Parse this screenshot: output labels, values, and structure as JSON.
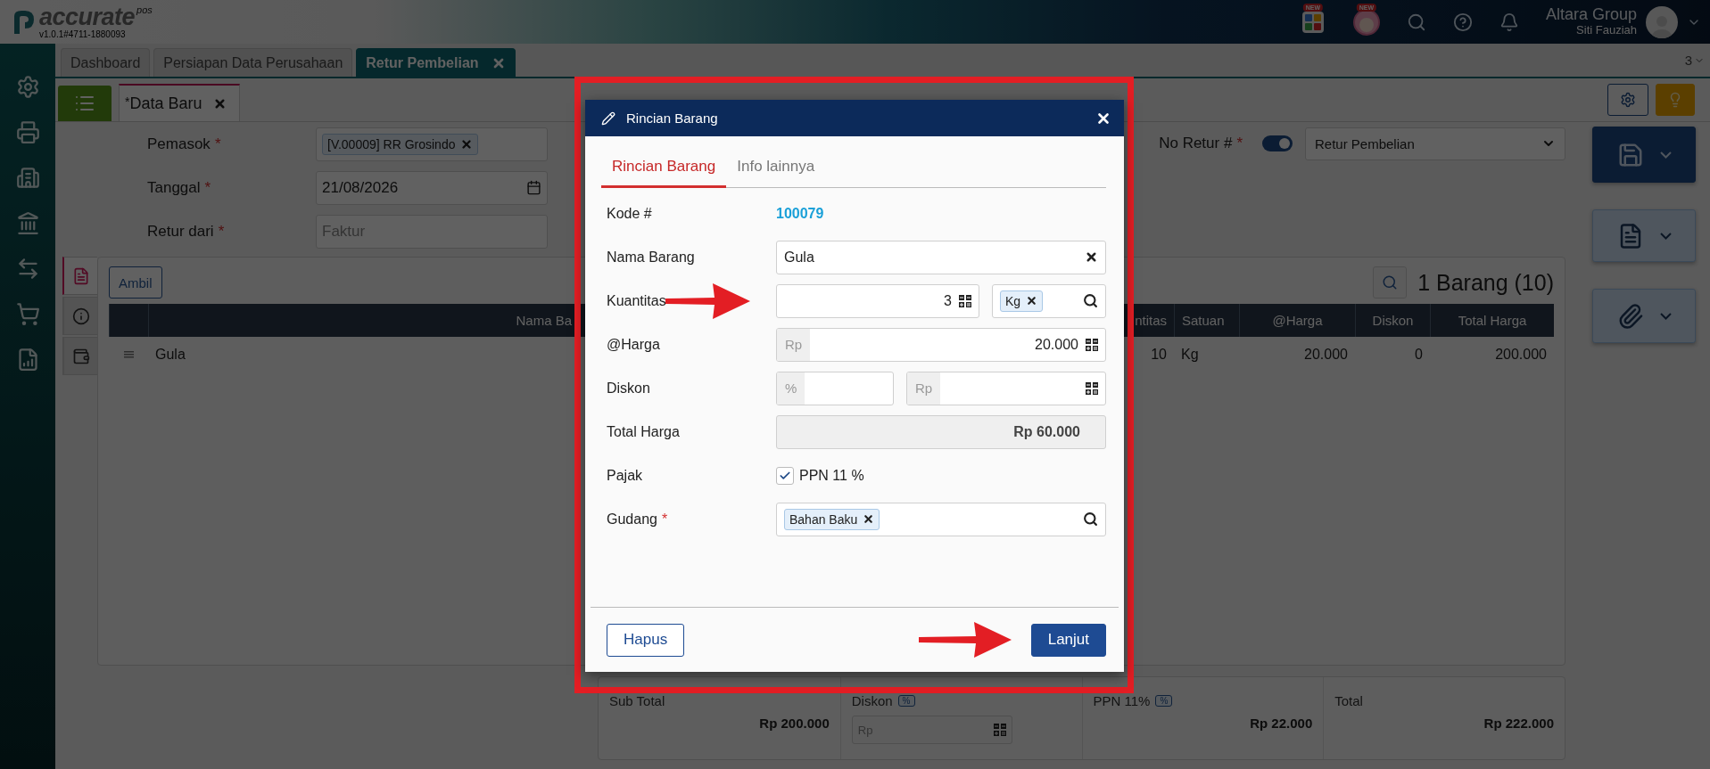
{
  "header": {
    "logo": "accurate",
    "logo_tag": "pos",
    "version": "v1.0.1#4711-1880093",
    "apps_badge": "NEW",
    "mascot_badge": "NEW",
    "company": "Altara Group",
    "user": "Siti Fauziah"
  },
  "tabs": [
    {
      "label": "Dashboard",
      "selected": false,
      "closable": false
    },
    {
      "label": "Persiapan Data Perusahaan",
      "selected": false,
      "closable": false
    },
    {
      "label": "Retur Pembelian",
      "selected": true,
      "closable": true
    }
  ],
  "tab_count": "3",
  "subtab": {
    "mark": "*",
    "label": "Data Baru"
  },
  "form": {
    "fields": [
      {
        "kind": "tag",
        "label": "Pemasok",
        "mark": "*",
        "value": "[V.00009] RR Grosindo"
      },
      {
        "kind": "date",
        "label": "Tanggal",
        "mark": "*",
        "value": "21/08/2026"
      },
      {
        "kind": "text",
        "label": "Retur dari",
        "mark": "*",
        "placeholder": "Faktur"
      }
    ],
    "number_label": "No Retur #",
    "number_mark": "*",
    "auto_number": true,
    "number_type": "Retur Pembelian"
  },
  "detail": {
    "side_tabs": [
      {
        "kind": "document",
        "selected": true
      },
      {
        "kind": "info",
        "selected": false
      },
      {
        "kind": "money",
        "selected": false
      }
    ],
    "fetch_button": "Ambil",
    "count": "1 Barang (10)",
    "columns": [
      "Nama Ba",
      "ntitas",
      "Satuan",
      "@Harga",
      "Diskon",
      "Total Harga"
    ],
    "rows": [
      {
        "name": "Gula",
        "quantity": "10",
        "unit": "Kg",
        "price": "20.000",
        "discount": "0",
        "total": "200.000"
      }
    ]
  },
  "summary": {
    "subtotal_label": "Sub Total",
    "subtotal": "Rp 200.000",
    "discount_label": "Diskon",
    "discount_badge": "%",
    "discount_placeholder": "Rp",
    "tax_label": "PPN 11%",
    "tax_badge": "%",
    "tax": "Rp 22.000",
    "total_label": "Total",
    "total": "Rp 222.000"
  },
  "dialog": {
    "title": "Rincian Barang",
    "tabs": [
      {
        "label": "Rincian Barang",
        "selected": true
      },
      {
        "label": "Info lainnya",
        "selected": false
      }
    ],
    "rows": [
      {
        "kind": "link",
        "label": "Kode #",
        "value": "100079"
      },
      {
        "kind": "text",
        "label": "Nama Barang",
        "value": "Gula"
      },
      {
        "kind": "quantity",
        "label": "Kuantitas",
        "value": "3",
        "unit": "Kg",
        "pointed": true
      },
      {
        "kind": "price",
        "label": "@Harga",
        "prefix": "Rp",
        "value": "20.000"
      },
      {
        "kind": "discount",
        "label": "Diskon",
        "percent_prefix": "%",
        "amount_prefix": "Rp"
      },
      {
        "kind": "readonly",
        "label": "Total Harga",
        "value": "Rp 60.000"
      },
      {
        "kind": "checkbox",
        "label": "Pajak",
        "option": "PPN 11 %",
        "checked": true
      },
      {
        "kind": "tag",
        "label": "Gudang",
        "mark": "*",
        "value": "Bahan Baku"
      }
    ],
    "buttons": [
      {
        "kind": "secondary",
        "label": "Hapus",
        "pointed": false
      },
      {
        "kind": "primary",
        "label": "Lanjut",
        "pointed": true
      }
    ]
  }
}
